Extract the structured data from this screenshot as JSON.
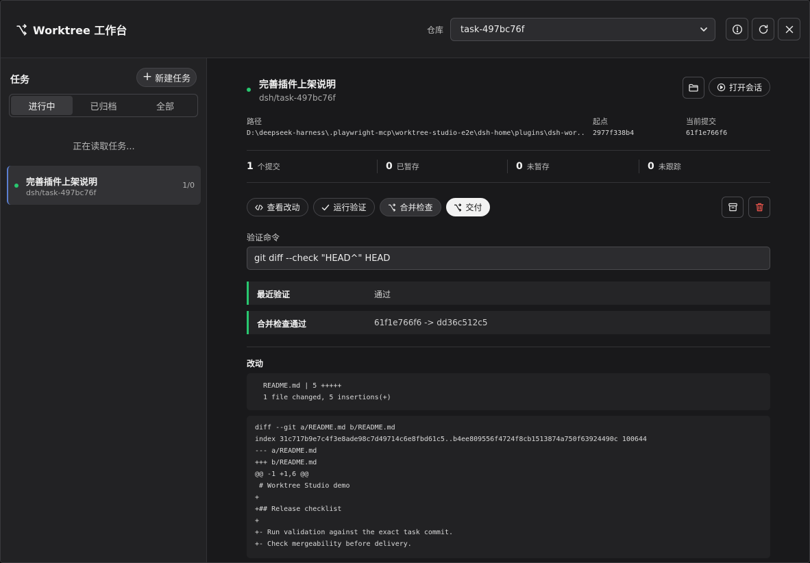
{
  "header": {
    "title": "Worktree 工作台",
    "repo_label": "仓库",
    "repo_value": "task-497bc76f",
    "icons": [
      "branch-icon",
      "info-icon",
      "refresh-icon",
      "close-icon"
    ]
  },
  "sidebar": {
    "title": "任务",
    "new_task_label": "新建任务",
    "tabs": [
      "进行中",
      "已归档",
      "全部"
    ],
    "active_tab": "进行中",
    "loading_text": "正在读取任务...",
    "tasks": [
      {
        "name": "完善插件上架说明",
        "branch": "dsh/task-497bc76f",
        "count": "1/0",
        "status_color": "#28c76f"
      }
    ]
  },
  "task": {
    "title": "完善插件上架说明",
    "branch": "dsh/task-497bc76f",
    "open_session_label": "打开会话",
    "path_label": "路径",
    "path_value": "D:\\deepseek-harness\\.playwright-mcp\\worktree-studio-e2e\\dsh-home\\plugins\\dsh-wor...",
    "origin_label": "起点",
    "origin_value": "2977f338b4",
    "current_commit_label": "当前提交",
    "current_commit_value": "61f1e766f6",
    "stats": [
      {
        "num": "1",
        "label": "个提交"
      },
      {
        "num": "0",
        "label": "已暂存"
      },
      {
        "num": "0",
        "label": "未暂存"
      },
      {
        "num": "0",
        "label": "未跟踪"
      }
    ],
    "actions": {
      "view_changes": "查看改动",
      "run_validation": "运行验证",
      "merge_check": "合并检查",
      "deliver": "交付"
    },
    "validation_cmd_label": "验证命令",
    "validation_cmd_value": "git diff --check \"HEAD^\" HEAD",
    "results": [
      {
        "key": "最近验证",
        "value": "通过"
      },
      {
        "key": "合并检查通过",
        "value": "61f1e766f6 -> dd36c512c5"
      }
    ],
    "changes_title": "改动",
    "stat_lines": [
      " README.md | 5 +++++",
      " 1 file changed, 5 insertions(+)"
    ],
    "diff_lines": [
      "diff --git a/README.md b/README.md",
      "index 31c717b9e7c4f3e8ade98c7d49714c6e8fbd61c5..b4ee809556f4724f8cb1513874a750f63924490c 100644",
      "--- a/README.md",
      "+++ b/README.md",
      "@@ -1 +1,6 @@",
      " # Worktree Studio demo",
      "+",
      "+## Release checklist",
      "+",
      "+- Run validation against the exact task commit.",
      "+- Check mergeability before delivery."
    ]
  },
  "colors": {
    "status_green": "#28c76f",
    "danger_red": "#e5534b",
    "selection_blue": "#5b7fd1"
  }
}
